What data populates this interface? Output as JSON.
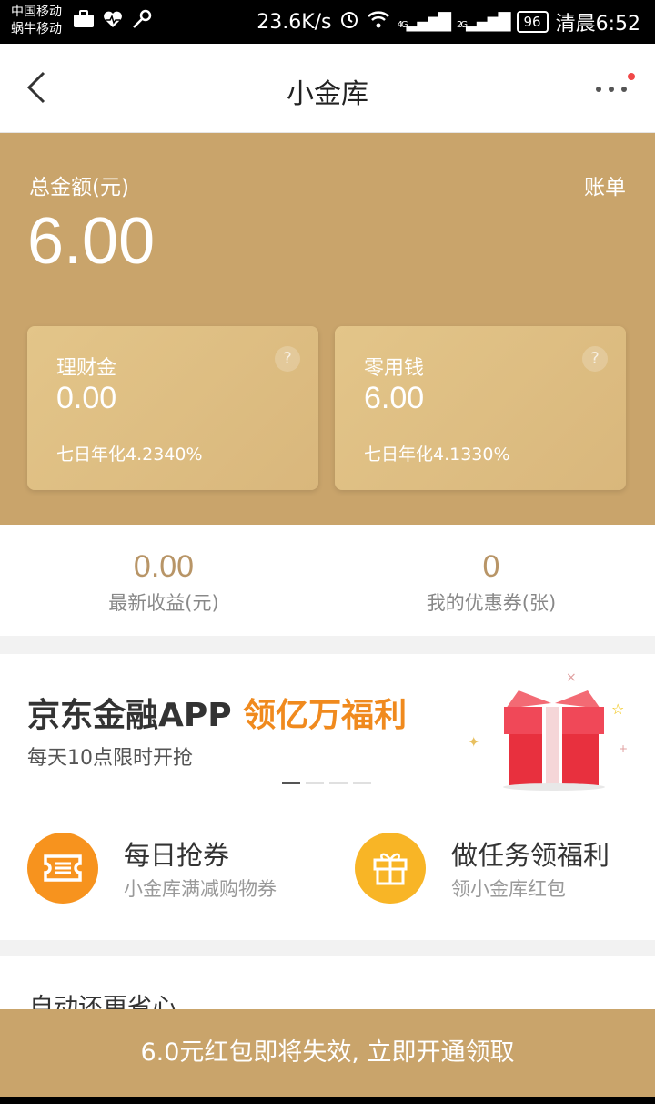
{
  "status_bar": {
    "carrier1": "中国移动",
    "carrier2": "蜗牛移动",
    "speed": "23.6K/s",
    "net1": "4G",
    "net2": "2G",
    "battery": "96",
    "time": "清晨6:52"
  },
  "header": {
    "title": "小金库"
  },
  "summary": {
    "total_label": "总金额(元)",
    "total_value": "6.00",
    "bill_label": "账单"
  },
  "cards": [
    {
      "title": "理财金",
      "value": "0.00",
      "rate": "七日年化4.2340%"
    },
    {
      "title": "零用钱",
      "value": "6.00",
      "rate": "七日年化4.1330%"
    }
  ],
  "stats": [
    {
      "value": "0.00",
      "label": "最新收益(元)"
    },
    {
      "value": "0",
      "label": "我的优惠券(张)"
    }
  ],
  "banner": {
    "title_main": "京东金融APP ",
    "title_highlight": "领亿万福利",
    "subtitle": "每天10点限时开抢",
    "page_count": 4,
    "active_page": 1
  },
  "features": [
    {
      "title": "每日抢券",
      "subtitle": "小金库满减购物券",
      "icon": "ticket-icon"
    },
    {
      "title": "做任务领福利",
      "subtitle": "领小金库红包",
      "icon": "gift-icon"
    }
  ],
  "auto_repay": {
    "title": "自动还更省心"
  },
  "bottom_bar": {
    "label": "6.0元红包即将失效, 立即开通领取"
  },
  "colors": {
    "gold": "#c9a46b",
    "stat_gold": "#b89567",
    "accent_orange": "#f08a1e",
    "icon_orange": "#f7931e",
    "icon_yellow": "#f8b526",
    "notice_dot": "#f04848"
  }
}
